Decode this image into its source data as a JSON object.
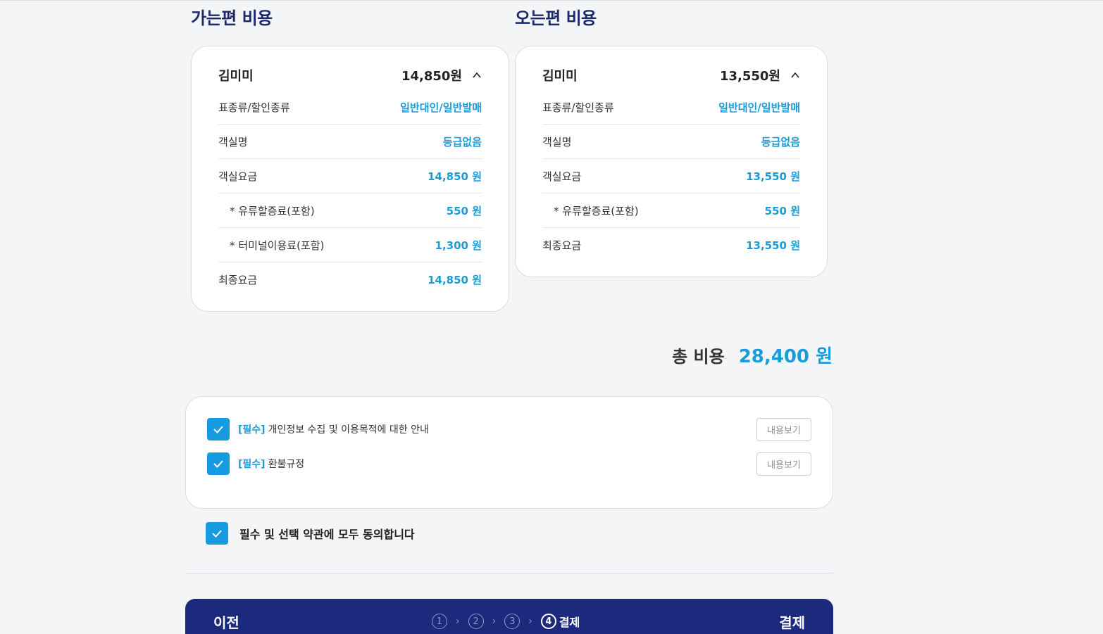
{
  "outbound": {
    "title": "가는편 비용",
    "passenger": "김미미",
    "amount": "14,850원",
    "rows": [
      {
        "label": "표종류/할인종류",
        "value": "일반대인/일반발매"
      },
      {
        "label": "객실명",
        "value": "등급없음"
      },
      {
        "label": "객실요금",
        "value": "14,850 원"
      },
      {
        "label": "* 유류할증료(포함)",
        "value": "550 원"
      },
      {
        "label": "* 터미널이용료(포함)",
        "value": "1,300 원"
      },
      {
        "label": "최종요금",
        "value": "14,850 원"
      }
    ]
  },
  "inbound": {
    "title": "오는편 비용",
    "passenger": "김미미",
    "amount": "13,550원",
    "rows": [
      {
        "label": "표종류/할인종류",
        "value": "일반대인/일반발매"
      },
      {
        "label": "객실명",
        "value": "등급없음"
      },
      {
        "label": "객실요금",
        "value": "13,550 원"
      },
      {
        "label": "* 유류할증료(포함)",
        "value": "550 원"
      },
      {
        "label": "최종요금",
        "value": "13,550 원"
      }
    ]
  },
  "total": {
    "label": "총 비용",
    "value": "28,400 원"
  },
  "terms": [
    {
      "tag": "[필수]",
      "text": "개인정보 수집 및 이용목적에 대한 안내",
      "button": "내용보기",
      "checked": true
    },
    {
      "tag": "[필수]",
      "text": "환불규정",
      "button": "내용보기",
      "checked": true
    }
  ],
  "agree_all": {
    "text": "필수 및 선택 약관에 모두 동의합니다",
    "checked": true
  },
  "footer": {
    "prev": "이전",
    "pay": "결제",
    "steps": [
      "1",
      "2",
      "3",
      "4"
    ],
    "current_step_label": "결제"
  },
  "colors": {
    "accent": "#1a9cd9",
    "navy": "#1b2a7d",
    "checkbox": "#169be0"
  }
}
